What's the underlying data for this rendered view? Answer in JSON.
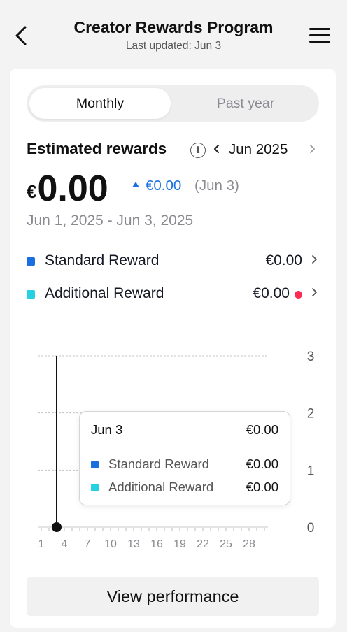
{
  "header": {
    "title": "Creator Rewards Program",
    "subtitle": "Last updated: Jun 3"
  },
  "tabs": [
    {
      "label": "Monthly",
      "active": true
    },
    {
      "label": "Past year",
      "active": false
    }
  ],
  "summary": {
    "title": "Estimated rewards",
    "period": "Jun 2025",
    "currency": "€",
    "amount": "0.00",
    "delta_value": "€0.00",
    "delta_date": "(Jun 3)",
    "date_range": "Jun 1, 2025 - Jun 3, 2025"
  },
  "legend": [
    {
      "label": "Standard Reward",
      "value": "€0.00",
      "color": "#1a6fe0"
    },
    {
      "label": "Additional Reward",
      "value": "€0.00",
      "color": "#25d0e0",
      "has_alert": true
    }
  ],
  "chart_data": {
    "type": "line",
    "x_ticks": [
      "1",
      "4",
      "7",
      "10",
      "13",
      "16",
      "19",
      "22",
      "25",
      "28"
    ],
    "y_ticks": [
      "0",
      "1",
      "2",
      "3"
    ],
    "ylim": [
      0,
      3
    ],
    "xlim": [
      1,
      30
    ],
    "series": [
      {
        "name": "Standard Reward",
        "x": [
          1,
          2,
          3
        ],
        "values": [
          0,
          0,
          0
        ],
        "color": "#1a6fe0"
      },
      {
        "name": "Additional Reward",
        "x": [
          1,
          2,
          3
        ],
        "values": [
          0,
          0,
          0
        ],
        "color": "#25d0e0"
      }
    ],
    "selected": {
      "x": 3,
      "y": 0
    }
  },
  "tooltip": {
    "date": "Jun 3",
    "total": "€0.00",
    "rows": [
      {
        "label": "Standard Reward",
        "value": "€0.00",
        "color": "#1a6fe0"
      },
      {
        "label": "Additional Reward",
        "value": "€0.00",
        "color": "#25d0e0"
      }
    ]
  },
  "footer": {
    "button_label": "View performance"
  }
}
